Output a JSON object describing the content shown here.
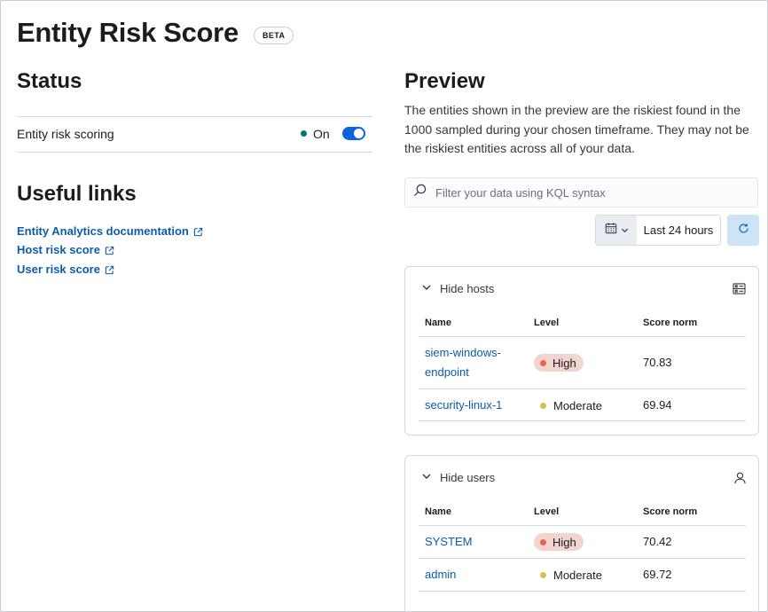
{
  "page": {
    "title": "Entity Risk Score",
    "beta_badge": "BETA"
  },
  "status": {
    "heading": "Status",
    "setting_label": "Entity risk scoring",
    "state": "On",
    "enabled": true,
    "status_color": "#007871",
    "toggle_color": "#0b64dd"
  },
  "links": {
    "heading": "Useful links",
    "items": [
      {
        "label": "Entity Analytics documentation"
      },
      {
        "label": "Host risk score"
      },
      {
        "label": "User risk score"
      }
    ]
  },
  "preview": {
    "heading": "Preview",
    "description": "The entities shown in the preview are the riskiest found in the 1000 sampled during your chosen timeframe. They may not be the riskiest entities across all of your data.",
    "search_placeholder": "Filter your data using KQL syntax",
    "search_value": "",
    "date_range": "Last 24 hours",
    "icons": {
      "search": "search-icon",
      "calendar": "calendar-icon",
      "refresh": "refresh-icon"
    }
  },
  "hosts_panel": {
    "toggle_label": "Hide hosts",
    "icon": "host-icon",
    "columns": [
      "Name",
      "Level",
      "Score norm"
    ],
    "rows": [
      {
        "name": "siem-windows-endpoint",
        "level": "High",
        "score": "70.83"
      },
      {
        "name": "security-linux-1",
        "level": "Moderate",
        "score": "69.94"
      }
    ]
  },
  "users_panel": {
    "toggle_label": "Hide users",
    "icon": "user-icon",
    "columns": [
      "Name",
      "Level",
      "Score norm"
    ],
    "rows": [
      {
        "name": "SYSTEM",
        "level": "High",
        "score": "70.42"
      },
      {
        "name": "admin",
        "level": "Moderate",
        "score": "69.72"
      }
    ]
  },
  "colors": {
    "link": "#0b5cad",
    "level_high_badge": "#f3d5d0",
    "level_high_dot": "#e7664c",
    "level_moderate_dot": "#d6bf57"
  }
}
